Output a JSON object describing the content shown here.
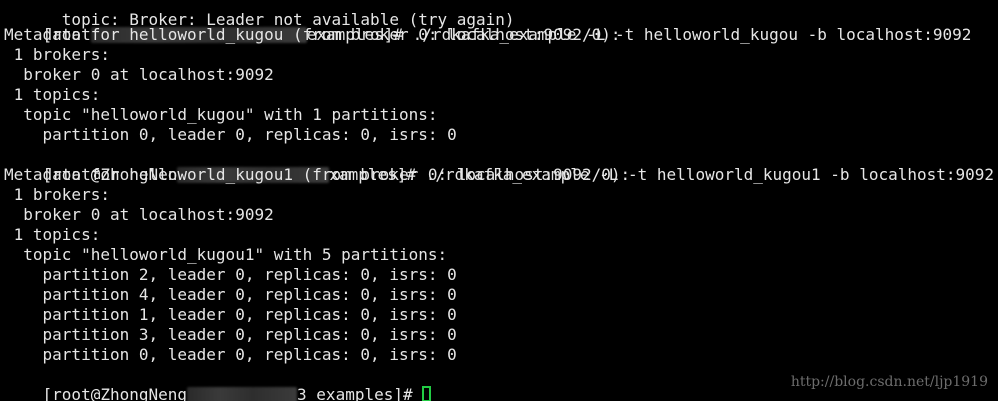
{
  "terminal": {
    "lines": {
      "l00": "  top",
      "l00b": "ic: Broker: Leader not available (try again)",
      "l01a": "[root",
      "l01b": "examples]# ./rdkafka_example -L -t helloworld_kugou -b localhost:9092",
      "l02": "Metadata for helloworld_kugou (from broker 0: localhost:9092/0):",
      "l03": " 1 brokers:",
      "l04": "  broker 0 at localhost:9092",
      "l05": " 1 topics:",
      "l06": "  topic \"helloworld_kugou\" with 1 partitions:",
      "l07": "    partition 0, leader 0, replicas: 0, isrs: 0",
      "l08a": "[root@ZhongNen",
      "l08b": "xamples]# ./rdkafka_example -L -t helloworld_kugou1 -b localhost:9092",
      "l09": "Metadata for helloworld_kugou1 (from broker 0: localhost:9092/0):",
      "l10": " 1 brokers:",
      "l11": "  broker 0 at localhost:9092",
      "l12": " 1 topics:",
      "l13": "  topic \"helloworld_kugou1\" with 5 partitions:",
      "l14": "    partition 2, leader 0, replicas: 0, isrs: 0",
      "l15": "    partition 4, leader 0, replicas: 0, isrs: 0",
      "l16": "    partition 1, leader 0, replicas: 0, isrs: 0",
      "l17": "    partition 3, leader 0, replicas: 0, isrs: 0",
      "l18": "    partition 0, leader 0, replicas: 0, isrs: 0",
      "l19a": "[root@ZhongNeng",
      "l19b": "3 examples]# "
    },
    "cursor_color": "#22cc44",
    "text_color": "#e6e6e6",
    "background": "#000000"
  },
  "watermark": {
    "text": "http://blog.csdn.net/ljp1919"
  }
}
